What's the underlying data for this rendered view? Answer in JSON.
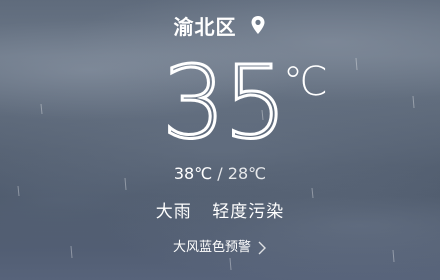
{
  "location": {
    "city": "渝北区",
    "icon": "location-pin-icon"
  },
  "current": {
    "temperature": "35",
    "unit": "℃"
  },
  "range": {
    "high": "38℃",
    "separator": "/",
    "low": "28℃"
  },
  "conditions": {
    "weather": "大雨",
    "air_quality": "轻度污染"
  },
  "alert": {
    "label": "大风蓝色预警",
    "icon": "chevron-right-icon"
  },
  "colors": {
    "text": "#ffffff",
    "sky_top": "#5f6b7c",
    "sky_bottom": "#4a5668"
  }
}
